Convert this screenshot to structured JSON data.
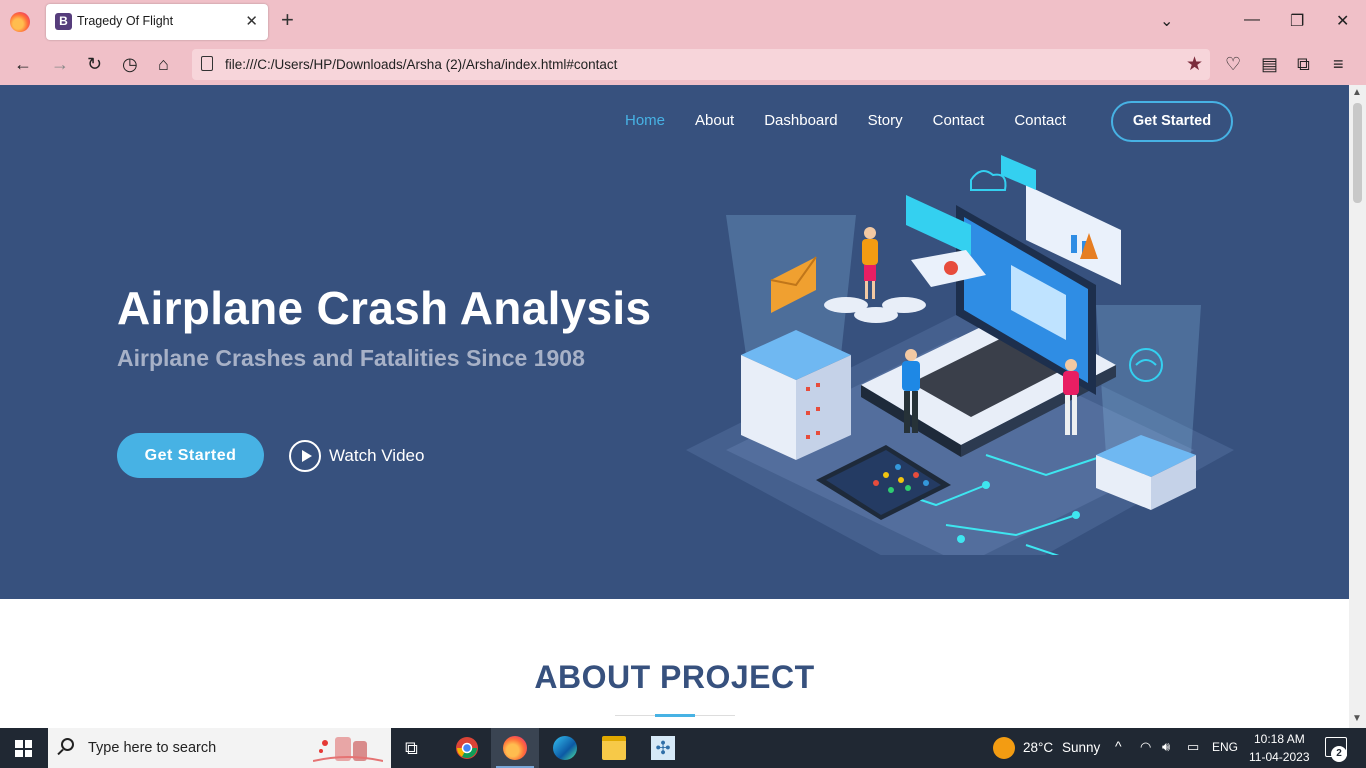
{
  "browser": {
    "tab_title": "Tragedy Of Flight",
    "tab_favicon_letter": "B",
    "url": "file:///C:/Users/HP/Downloads/Arsha (2)/Arsha/index.html#contact"
  },
  "site": {
    "nav": {
      "items": [
        "Home",
        "About",
        "Dashboard",
        "Story",
        "Contact",
        "Contact"
      ],
      "active_index": 0,
      "cta_label": "Get Started"
    },
    "hero": {
      "title": "Airplane Crash Analysis",
      "subtitle": "Airplane Crashes and Fatalities Since 1908",
      "primary_button": "Get Started",
      "video_label": "Watch Video"
    },
    "about": {
      "title": "ABOUT PROJECT"
    },
    "colors": {
      "hero_bg": "#37517e",
      "accent": "#47b2e4"
    }
  },
  "taskbar": {
    "search_placeholder": "Type here to search",
    "weather_temp": "28°C",
    "weather_text": "Sunny",
    "language": "ENG",
    "time": "10:18 AM",
    "date": "11-04-2023",
    "notification_count": "2"
  }
}
